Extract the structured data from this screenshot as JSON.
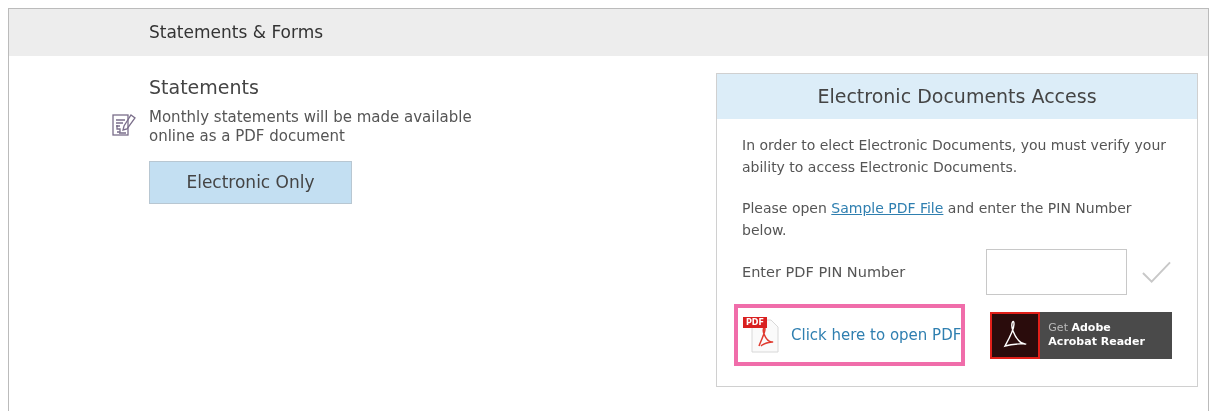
{
  "header": {
    "title": "Statements & Forms"
  },
  "statements": {
    "title": "Statements",
    "description": "Monthly statements will be made available online as a PDF document",
    "button": "Electronic Only"
  },
  "access_card": {
    "title": "Electronic Documents Access",
    "intro": "In order to elect Electronic Documents, you must verify your ability to access Electronic Documents.",
    "instruction_before": "Please open ",
    "instruction_link": "Sample PDF File",
    "instruction_after": " and enter the PIN Number below.",
    "pin_label": "Enter PDF PIN Number",
    "pdf_icon_label": "PDF",
    "open_pdf_link": {
      "text": "Click here to open PDF",
      "highlighted": true
    },
    "adobe_badge": {
      "line_1": "Get **Adobe**",
      "line_2": "Acrobat Reader"
    }
  }
}
